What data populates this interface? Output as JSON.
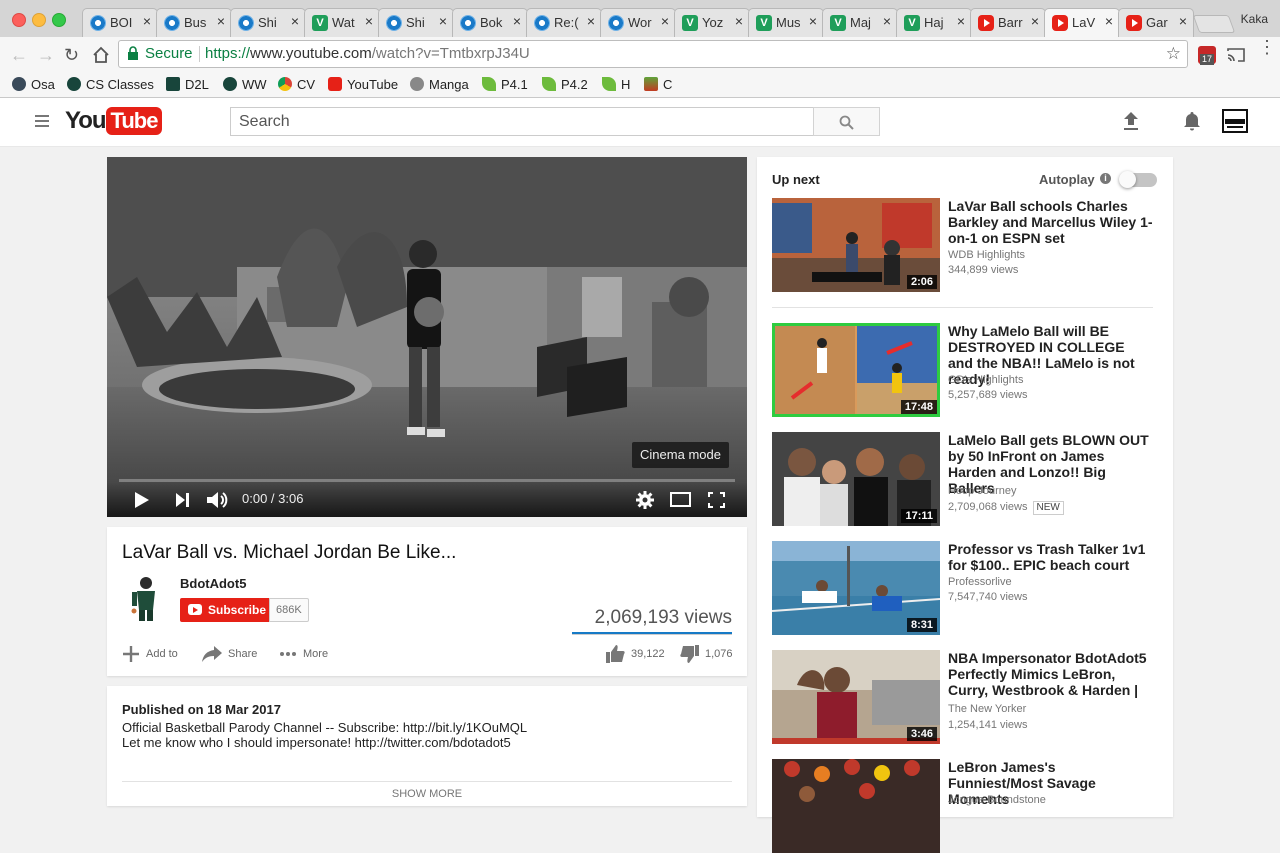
{
  "browser": {
    "tabs": [
      {
        "title": "BOI",
        "favicon": "blue-flower"
      },
      {
        "title": "Bus",
        "favicon": "blue-flower"
      },
      {
        "title": "Shi",
        "favicon": "blue-flower"
      },
      {
        "title": "Wat",
        "favicon": "green-v"
      },
      {
        "title": "Shi",
        "favicon": "blue-flower"
      },
      {
        "title": "Bok",
        "favicon": "blue-flower"
      },
      {
        "title": "Re:(",
        "favicon": "blue-flower"
      },
      {
        "title": "Wor",
        "favicon": "blue-flower"
      },
      {
        "title": "Yoz",
        "favicon": "green-v"
      },
      {
        "title": "Mus",
        "favicon": "green-v"
      },
      {
        "title": "Maj",
        "favicon": "green-v"
      },
      {
        "title": "Haj",
        "favicon": "green-v"
      },
      {
        "title": "Barr",
        "favicon": "youtube"
      },
      {
        "title": "LaV",
        "favicon": "youtube"
      },
      {
        "title": "Gar",
        "favicon": "youtube"
      }
    ],
    "profile_name": "Kaka",
    "secure_label": "Secure",
    "url_proto": "https://",
    "url_host": "www.youtube.com",
    "url_path": "/watch?v=TmtbxrpJ34U",
    "extension_badge": "17",
    "bookmarks": [
      "Osa",
      "CS Classes",
      "D2L",
      "WW",
      "CV",
      "YouTube",
      "Manga",
      "P4.1",
      "P4.2",
      "H",
      "C"
    ]
  },
  "yt_header": {
    "logo_you": "You",
    "logo_tube": "Tube",
    "search_placeholder": "Search"
  },
  "player": {
    "cinema_tooltip": "Cinema mode",
    "time_display": "0:00 / 3:06",
    "progress": 0
  },
  "video": {
    "title": "LaVar Ball vs. Michael Jordan Be Like...",
    "channel": "BdotAdot5",
    "subscribe_label": "Subscribe",
    "subscriber_count": "686K",
    "views": "2,069,193 views",
    "add_to_label": "Add to",
    "share_label": "Share",
    "more_label": "More",
    "likes": "39,122",
    "dislikes": "1,076"
  },
  "description": {
    "published": "Published on 18 Mar 2017",
    "line1": "Official Basketball Parody Channel -- Subscribe: http://bit.ly/1KOuMQL",
    "line2": "Let me know who I should impersonate! http://twitter.com/bdotadot5",
    "show_more": "SHOW MORE"
  },
  "sidebar": {
    "up_next_label": "Up next",
    "autoplay_label": "Autoplay",
    "videos": [
      {
        "title": "LaVar Ball schools Charles Barkley and Marcellus Wiley 1-on-1 on ESPN set",
        "channel": "WDB Highlights",
        "views": "344,899 views",
        "duration": "2:06",
        "badge": ""
      },
      {
        "title": "Why LaMelo Ball will BE DESTROYED IN COLLEGE and the NBA!! LaMelo is not ready!",
        "channel": "GD's Highlights",
        "views": "5,257,689 views",
        "duration": "17:48",
        "badge": ""
      },
      {
        "title": "LaMelo Ball gets BLOWN OUT by 50 InFront on James Harden and Lonzo!! Big Ballers",
        "channel": "Hoop Journey",
        "views": "2,709,068 views",
        "duration": "17:11",
        "badge": "NEW"
      },
      {
        "title": "Professor vs Trash Talker 1v1 for $100.. EPIC beach court",
        "channel": "Professorlive",
        "views": "7,547,740 views",
        "duration": "8:31",
        "badge": ""
      },
      {
        "title": "NBA Impersonator BdotAdot5 Perfectly Mimics LeBron, Curry, Westbrook & Harden |",
        "channel": "The New Yorker",
        "views": "1,254,141 views",
        "duration": "3:46",
        "badge": ""
      },
      {
        "title": "LeBron James's Funniest/Most Savage Moments",
        "channel": "Jongue Boundstone",
        "views": "",
        "duration": "",
        "badge": ""
      }
    ]
  },
  "colors": {
    "youtube_red": "#e62117",
    "secure_green": "#0b8043",
    "link_blue": "#167ac6"
  }
}
